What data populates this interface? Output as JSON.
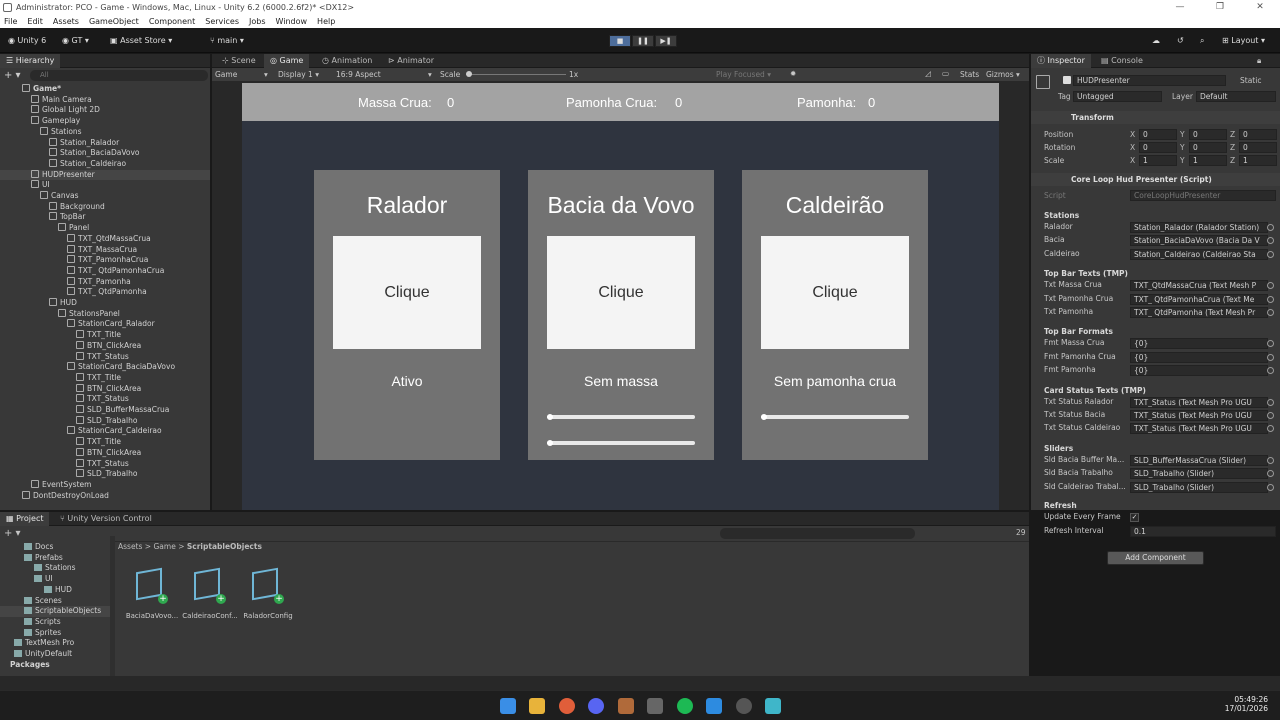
{
  "window": {
    "title": "Administrator: PCO - Game - Windows, Mac, Linux - Unity 6.2 (6000.2.6f2)* <DX12>"
  },
  "menu": [
    "File",
    "Edit",
    "Assets",
    "GameObject",
    "Component",
    "Services",
    "Jobs",
    "Window",
    "Help"
  ],
  "toolbar": {
    "unity": "Unity 6",
    "account": "GT",
    "asset_store": "Asset Store",
    "branch": "main",
    "layout": "Layout"
  },
  "hierarchy": {
    "tab": "Hierarchy",
    "search_placeholder": "All",
    "rows": [
      {
        "t": "Game*",
        "d": 0,
        "bold": true
      },
      {
        "t": "Main Camera",
        "d": 1
      },
      {
        "t": "Global Light 2D",
        "d": 1
      },
      {
        "t": "Gameplay",
        "d": 1
      },
      {
        "t": "Stations",
        "d": 2
      },
      {
        "t": "Station_Ralador",
        "d": 3
      },
      {
        "t": "Station_BaciaDaVovo",
        "d": 3
      },
      {
        "t": "Station_Caldeirao",
        "d": 3
      },
      {
        "t": "HUDPresenter",
        "d": 1,
        "sel": true
      },
      {
        "t": "UI",
        "d": 1
      },
      {
        "t": "Canvas",
        "d": 2
      },
      {
        "t": "Background",
        "d": 3
      },
      {
        "t": "TopBar",
        "d": 3
      },
      {
        "t": "Panel",
        "d": 4
      },
      {
        "t": "TXT_QtdMassaCrua",
        "d": 5
      },
      {
        "t": "TXT_MassaCrua",
        "d": 5
      },
      {
        "t": "TXT_PamonhaCrua",
        "d": 5
      },
      {
        "t": "TXT_ QtdPamonhaCrua",
        "d": 5
      },
      {
        "t": "TXT_Pamonha",
        "d": 5
      },
      {
        "t": "TXT_ QtdPamonha",
        "d": 5
      },
      {
        "t": "HUD",
        "d": 3
      },
      {
        "t": "StationsPanel",
        "d": 4
      },
      {
        "t": "StationCard_Ralador",
        "d": 5
      },
      {
        "t": "TXT_Title",
        "d": 6
      },
      {
        "t": "BTN_ClickArea",
        "d": 6
      },
      {
        "t": "TXT_Status",
        "d": 6
      },
      {
        "t": "StationCard_BaciaDaVovo",
        "d": 5
      },
      {
        "t": "TXT_Title",
        "d": 6
      },
      {
        "t": "BTN_ClickArea",
        "d": 6
      },
      {
        "t": "TXT_Status",
        "d": 6
      },
      {
        "t": "SLD_BufferMassaCrua",
        "d": 6
      },
      {
        "t": "SLD_Trabalho",
        "d": 6
      },
      {
        "t": "StationCard_Caldeirao",
        "d": 5
      },
      {
        "t": "TXT_Title",
        "d": 6
      },
      {
        "t": "BTN_ClickArea",
        "d": 6
      },
      {
        "t": "TXT_Status",
        "d": 6
      },
      {
        "t": "SLD_Trabalho",
        "d": 6
      },
      {
        "t": "EventSystem",
        "d": 1
      },
      {
        "t": "DontDestroyOnLoad",
        "d": 0
      }
    ]
  },
  "center_tabs": {
    "scene": "Scene",
    "game": "Game",
    "animation": "Animation",
    "animator": "Animator"
  },
  "game_toolbar": {
    "mode": "Game",
    "display": "Display 1",
    "aspect": "16:9 Aspect",
    "scale_label": "Scale",
    "scale_value": "1x",
    "play_focused": "Play Focused",
    "stats": "Stats",
    "gizmos": "Gizmos"
  },
  "game": {
    "topbar": {
      "massa_label": "Massa Crua:",
      "massa_value": "0",
      "pamcrua_label": "Pamonha Crua:",
      "pamcrua_value": "0",
      "pamonha_label": "Pamonha:",
      "pamonha_value": "0"
    },
    "cards": [
      {
        "title": "Ralador",
        "button": "Clique",
        "status": "Ativo",
        "sliders": []
      },
      {
        "title": "Bacia da Vovo",
        "button": "Clique",
        "status": "Sem massa",
        "sliders": [
          0,
          0
        ]
      },
      {
        "title": "Caldeirão",
        "button": "Clique",
        "status": "Sem pamonha crua",
        "sliders": [
          0
        ]
      }
    ]
  },
  "inspector": {
    "tabs": {
      "inspector": "Inspector",
      "console": "Console"
    },
    "object_name": "HUDPresenter",
    "static": "Static",
    "tag_label": "Tag",
    "tag": "Untagged",
    "layer_label": "Layer",
    "layer": "Default",
    "transform": {
      "header": "Transform",
      "position": "Position",
      "rotation": "Rotation",
      "scale": "Scale",
      "pos": [
        "0",
        "0",
        "0"
      ],
      "rot": [
        "0",
        "0",
        "0"
      ],
      "scl": [
        "1",
        "1",
        "1"
      ]
    },
    "script_header": "Core Loop Hud Presenter (Script)",
    "script_label": "Script",
    "script_value": "CoreLoopHudPresenter",
    "sections": [
      {
        "title": "Stations",
        "rows": [
          [
            "Ralador",
            "Station_Ralador (Ralador Station)"
          ],
          [
            "Bacia",
            "Station_BaciaDaVovo (Bacia Da V"
          ],
          [
            "Caldeirao",
            "Station_Caldeirao (Caldeirao Sta"
          ]
        ]
      },
      {
        "title": "Top Bar Texts (TMP)",
        "rows": [
          [
            "Txt Massa Crua",
            "TXT_QtdMassaCrua (Text Mesh P"
          ],
          [
            "Txt Pamonha Crua",
            "TXT_ QtdPamonhaCrua (Text Me"
          ],
          [
            "Txt Pamonha",
            "TXT_ QtdPamonha (Text Mesh Pr"
          ]
        ]
      },
      {
        "title": "Top Bar Formats",
        "rows": [
          [
            "Fmt Massa Crua",
            "{0}"
          ],
          [
            "Fmt Pamonha Crua",
            "{0}"
          ],
          [
            "Fmt Pamonha",
            "{0}"
          ]
        ]
      },
      {
        "title": "Card Status Texts (TMP)",
        "rows": [
          [
            "Txt Status Ralador",
            "TXT_Status (Text Mesh Pro UGU"
          ],
          [
            "Txt Status Bacia",
            "TXT_Status (Text Mesh Pro UGU"
          ],
          [
            "Txt Status Caldeirao",
            "TXT_Status (Text Mesh Pro UGU"
          ]
        ]
      },
      {
        "title": "Sliders",
        "rows": [
          [
            "Sld Bacia Buffer Ma...",
            "SLD_BufferMassaCrua (Slider)"
          ],
          [
            "Sld Bacia Trabalho",
            "SLD_Trabalho (Slider)"
          ],
          [
            "Sld Caldeirao Trabal...",
            "SLD_Trabalho (Slider)"
          ]
        ]
      }
    ],
    "refresh": {
      "title": "Refresh",
      "update_label": "Update Every Frame",
      "interval_label": "Refresh Interval",
      "interval": "0.1"
    },
    "add_component": "Add Component"
  },
  "project": {
    "tabs": {
      "project": "Project",
      "vcs": "Unity Version Control"
    },
    "breadcrumb": [
      "Assets",
      "Game",
      "ScriptableObjects"
    ],
    "count": "29",
    "tree": [
      {
        "t": "Docs",
        "d": 1
      },
      {
        "t": "Prefabs",
        "d": 1
      },
      {
        "t": "Stations",
        "d": 2
      },
      {
        "t": "UI",
        "d": 2
      },
      {
        "t": "HUD",
        "d": 3
      },
      {
        "t": "Scenes",
        "d": 1
      },
      {
        "t": "ScriptableObjects",
        "d": 1,
        "sel": true
      },
      {
        "t": "Scripts",
        "d": 1
      },
      {
        "t": "Sprites",
        "d": 1
      },
      {
        "t": "TextMesh Pro",
        "d": 0
      },
      {
        "t": "UnityDefault",
        "d": 0
      },
      {
        "t": "Packages",
        "d": -1
      }
    ],
    "assets": [
      "BaciaDaVovo...",
      "CaldeiraoConf...",
      "RaladorConfig"
    ]
  },
  "clock": {
    "time": "05:49:26",
    "date": "17/01/2026"
  }
}
